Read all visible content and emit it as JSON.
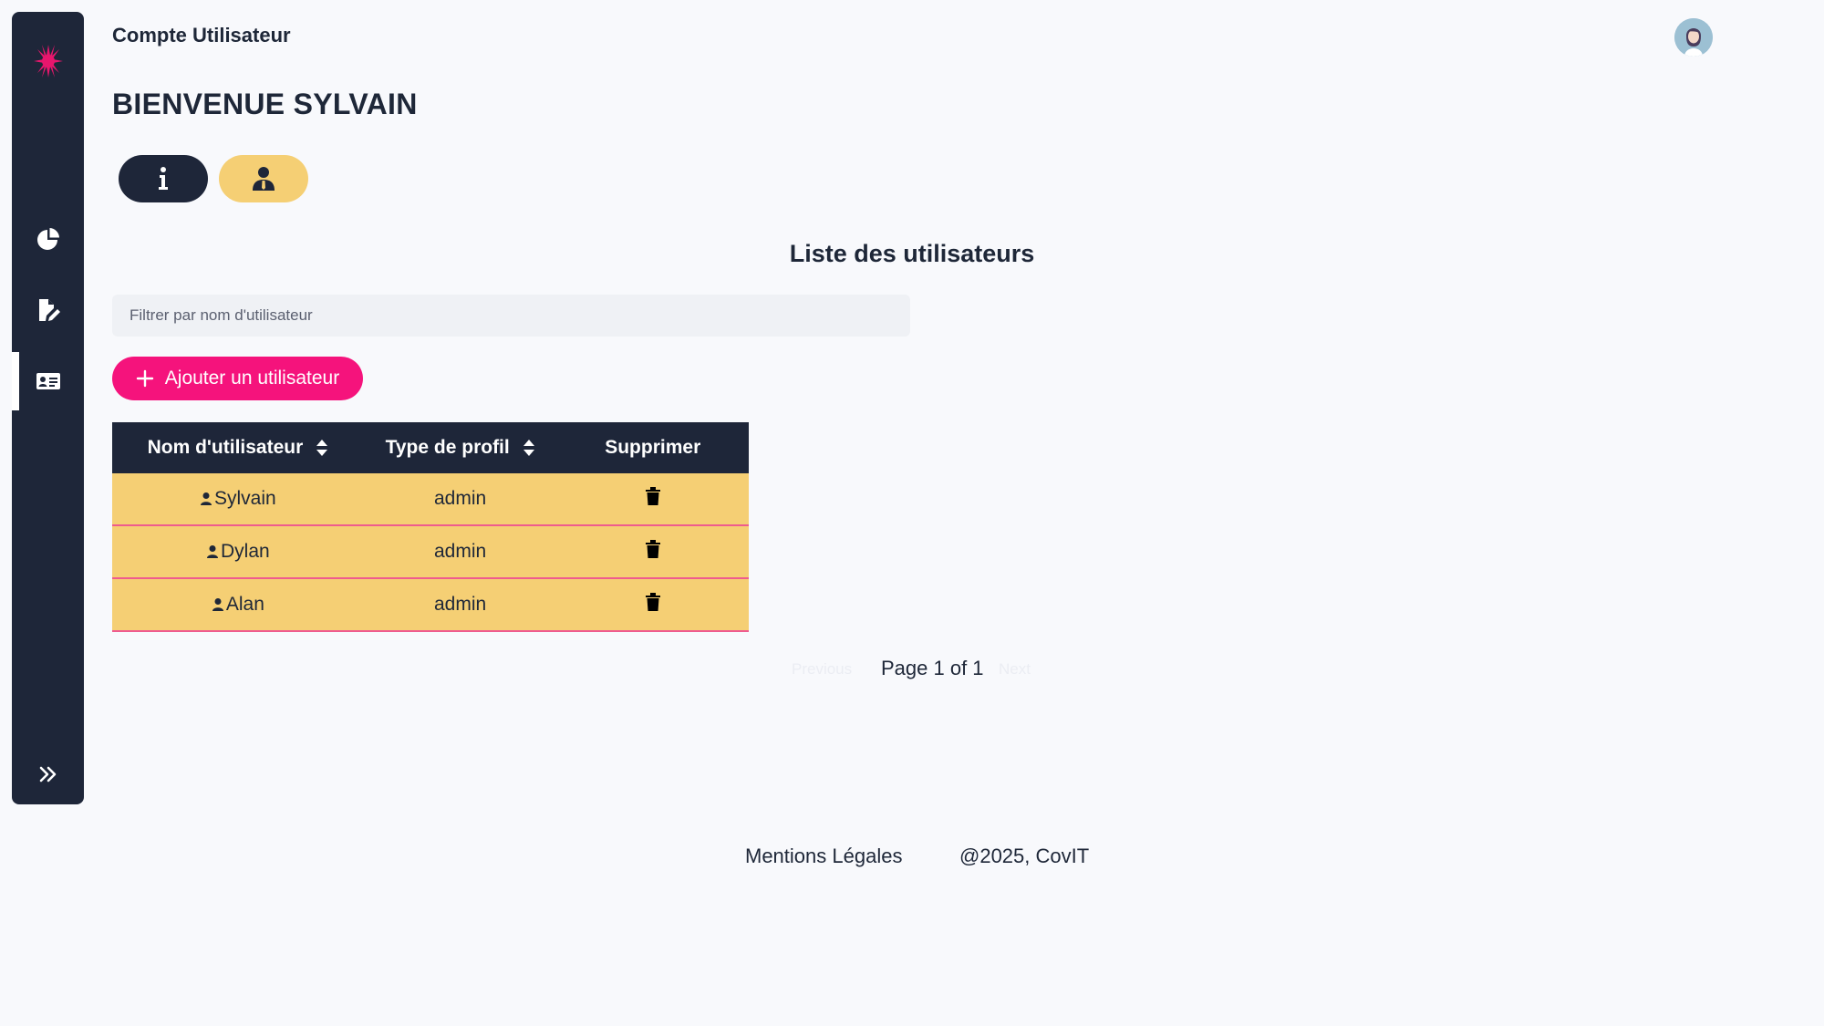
{
  "header": {
    "title": "Compte Utilisateur"
  },
  "welcome": "BIENVENUE SYLVAIN",
  "tabs": [
    {
      "icon": "info-icon"
    },
    {
      "icon": "user-tie-icon"
    }
  ],
  "section_title": "Liste des utilisateurs",
  "filter": {
    "placeholder": "Filtrer par nom d'utilisateur",
    "value": ""
  },
  "add_button": {
    "label": "Ajouter un utilisateur",
    "icon": "plus-icon"
  },
  "table": {
    "headers": [
      "Nom d'utilisateur",
      "Type de profil",
      "Supprimer"
    ],
    "rows": [
      {
        "username": "Sylvain",
        "profile": "admin"
      },
      {
        "username": "Dylan",
        "profile": "admin"
      },
      {
        "username": "Alan",
        "profile": "admin"
      }
    ]
  },
  "pagination": {
    "previous": "Previous",
    "text": "Page 1 of 1",
    "next": "Next"
  },
  "footer": {
    "legal": "Mentions Légales",
    "copyright": "@2025, CovIT"
  },
  "colors": {
    "sidebar": "#1e2639",
    "accent_yellow": "#f5cf74",
    "accent_pink": "#f5137c",
    "background": "#f8f9fc"
  },
  "sidebar_icons": [
    "logo-icon",
    "pie-chart-icon",
    "file-edit-icon",
    "id-card-icon",
    "double-chevron-right-icon"
  ]
}
